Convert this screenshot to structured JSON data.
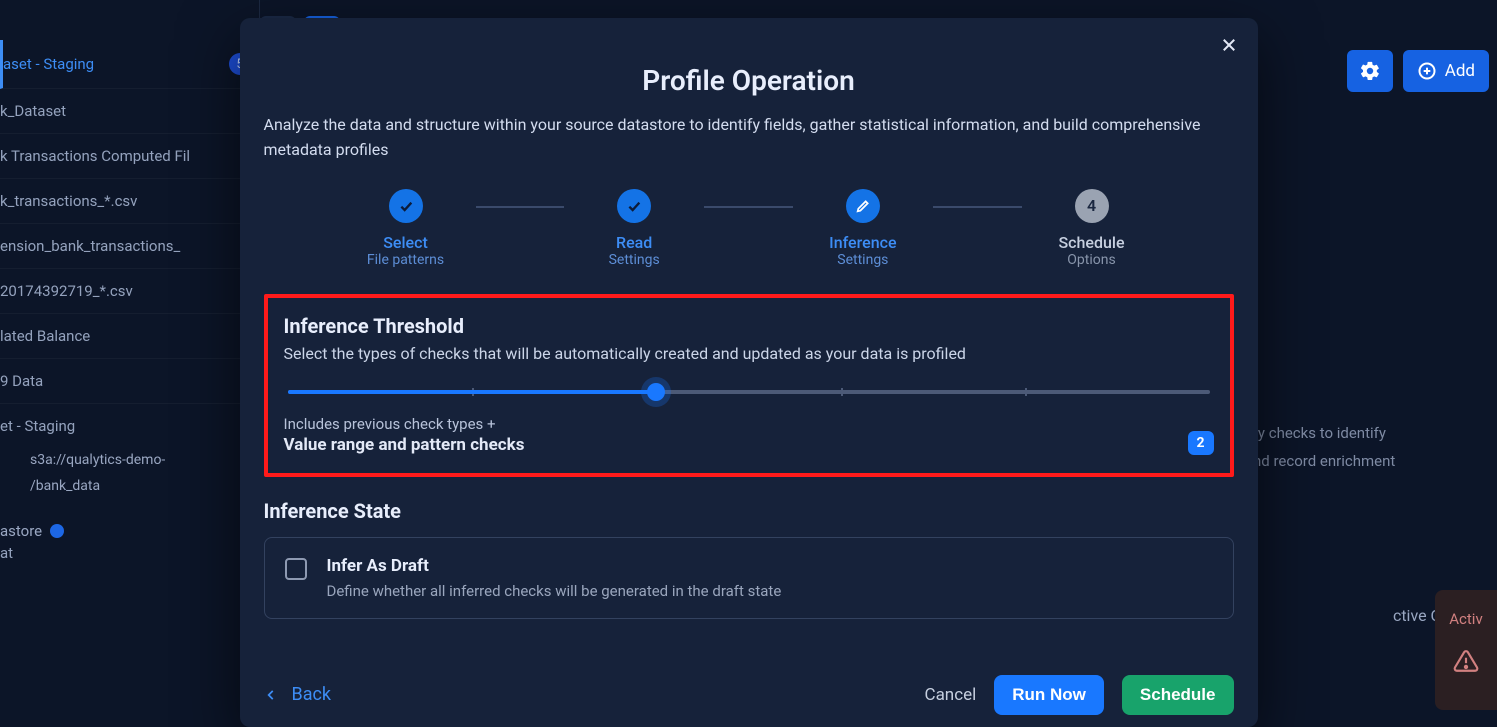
{
  "sidebar": {
    "active_item": "aset - Staging",
    "active_badge": "5",
    "items": [
      "k_Dataset",
      "k Transactions Computed Fil",
      "k_transactions_*.csv",
      "ension_bank_transactions_",
      "20174392719_*.csv",
      "lated Balance",
      "9 Data"
    ],
    "section_item": "et - Staging",
    "path_line1": "s3a://qualytics-demo-",
    "path_line2": "/bank_data",
    "datastore_label": "astore",
    "datastore_sub": "at"
  },
  "topbar": {
    "add_label": "Add"
  },
  "bg": {
    "right_para_l1": "ty checks to identify",
    "right_para_l2": "nd record enrichment",
    "active_checks_label": "ctive Checks",
    "activ_tab": "Activ"
  },
  "modal": {
    "title": "Profile Operation",
    "description": "Analyze the data and structure within your source datastore to identify fields, gather statistical information, and build comprehensive metadata profiles",
    "steps": [
      {
        "title": "Select",
        "sub": "File patterns",
        "state": "done"
      },
      {
        "title": "Read",
        "sub": "Settings",
        "state": "done"
      },
      {
        "title": "Inference",
        "sub": "Settings",
        "state": "active"
      },
      {
        "title": "Schedule",
        "sub": "Options",
        "state": "idle",
        "num": "4"
      }
    ],
    "threshold": {
      "title": "Inference Threshold",
      "subtitle": "Select the types of checks that will be automatically created and updated as your data is profiled",
      "caption_pre": "Includes previous check types +",
      "caption_strong": "Value range and pattern checks",
      "badge": "2",
      "slider_percent": 40
    },
    "state": {
      "title": "Inference State",
      "item_title": "Infer As Draft",
      "item_sub": "Define whether all inferred checks will be generated in the draft state"
    },
    "footer": {
      "back": "Back",
      "cancel": "Cancel",
      "run": "Run Now",
      "schedule": "Schedule"
    }
  }
}
